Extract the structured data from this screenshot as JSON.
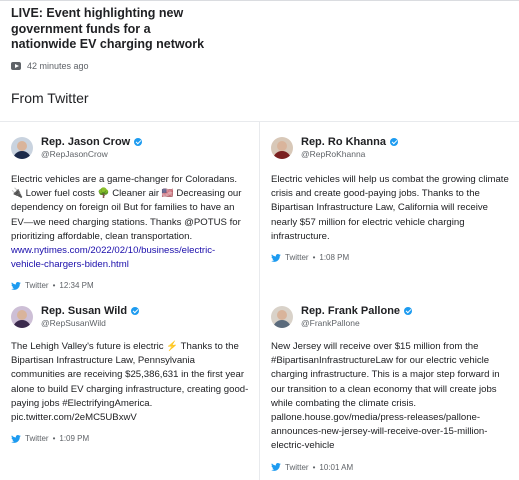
{
  "live_story": {
    "title": "LIVE: Event highlighting new government funds for a nationwide EV charging network",
    "icon": "video-icon",
    "time": "42 minutes ago"
  },
  "section": {
    "heading": "From Twitter"
  },
  "tweets": [
    {
      "name": "Rep. Jason Crow",
      "handle": "@RepJasonCrow",
      "text": "Electric vehicles are a game-changer for Coloradans. 🔌 Lower fuel costs 🌳 Cleaner air 🇺🇸 Decreasing our dependency on foreign oil But for families to have an EV—we need charging stations. Thanks @POTUS for prioritizing affordable, clean transportation.",
      "link": "www.nytimes.com/2022/02/10/business/electric-vehicle-chargers-biden.html",
      "source": "Twitter",
      "time": "12:34 PM",
      "avatar_color": "#1c2a4a"
    },
    {
      "name": "Rep. Ro Khanna",
      "handle": "@RepRoKhanna",
      "text": "Electric vehicles will help us combat the growing climate crisis and create good-paying jobs. Thanks to the Bipartisan Infrastructure Law, California will receive nearly $57 million for electric vehicle charging infrastructure.",
      "link": "",
      "source": "Twitter",
      "time": "1:08 PM",
      "avatar_color": "#7a1f1f"
    },
    {
      "name": "Rep. Susan Wild",
      "handle": "@RepSusanWild",
      "text": "The Lehigh Valley's future is electric ⚡ Thanks to the Bipartisan Infrastructure Law, Pennsylvania communities are receiving $25,386,631 in the first year alone to build EV charging infrastructure, creating good-paying jobs #ElectrifyingAmerica. pic.twitter.com/2eMC5UBxwV",
      "link": "",
      "source": "Twitter",
      "time": "1:09 PM",
      "avatar_color": "#3b2a4d"
    },
    {
      "name": "Rep. Frank Pallone",
      "handle": "@FrankPallone",
      "text": "New Jersey will receive over $15 million from the #BipartisanInfrastructureLaw for our electric vehicle charging infrastructure. This is a major step forward in our transition to a clean economy that will create jobs while combating the climate crisis. pallone.house.gov/media/press-releases/pallone-announces-new-jersey-will-receive-over-15-million-electric-vehicle",
      "link": "",
      "source": "Twitter",
      "time": "10:01 AM",
      "avatar_color": "#5b6b7c"
    }
  ],
  "colors": {
    "link": "#1a0dab",
    "twitter_blue": "#1d9bf0",
    "muted": "#5f6368"
  }
}
